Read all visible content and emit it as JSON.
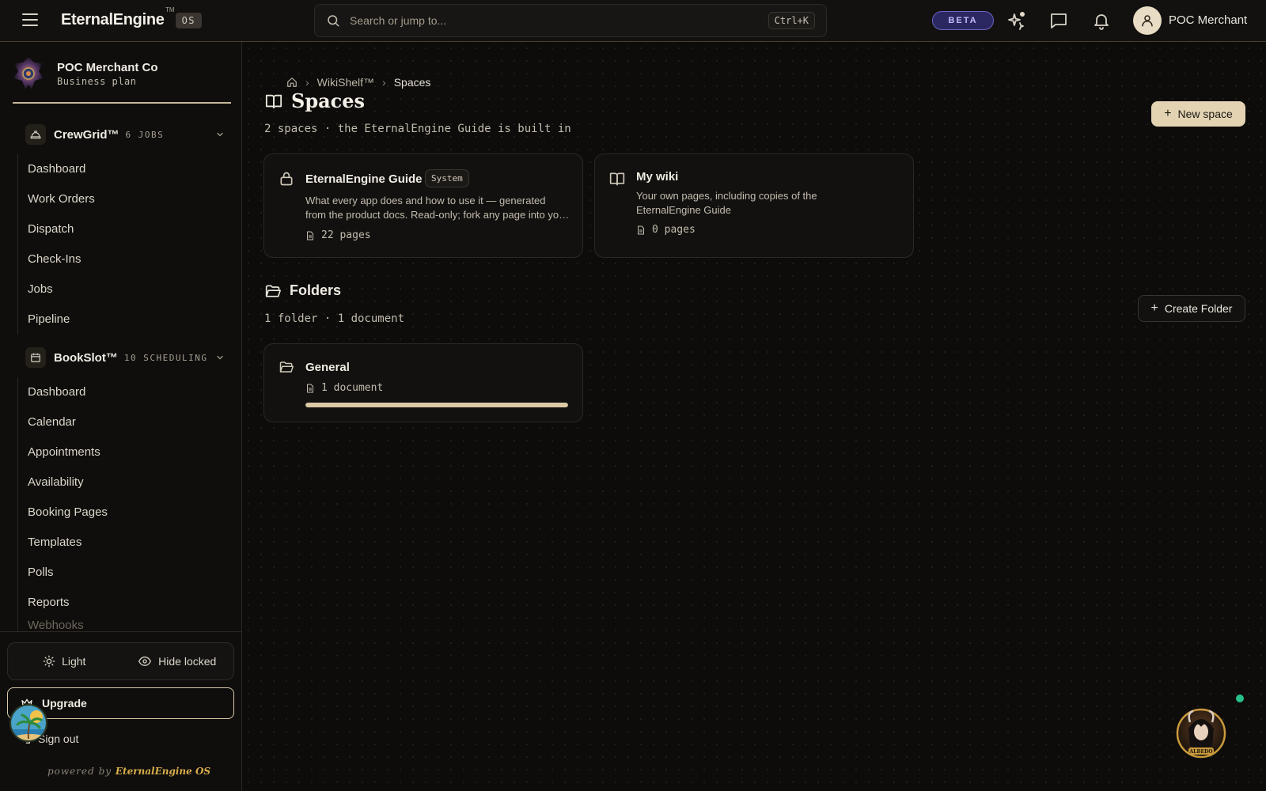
{
  "topbar": {
    "brand": "EternalEngine",
    "brand_tm": "TM",
    "brand_os": "OS",
    "search_placeholder": "Search or jump to...",
    "search_shortcut": "Ctrl+K",
    "beta_label": "BETA",
    "user_name": "POC Merchant"
  },
  "sidebar": {
    "org_name": "POC Merchant Co",
    "org_plan": "Business plan",
    "apps": [
      {
        "name": "CrewGrid™",
        "meta": "6 JOBS",
        "items": [
          "Dashboard",
          "Work Orders",
          "Dispatch",
          "Check-Ins",
          "Jobs",
          "Pipeline"
        ]
      },
      {
        "name": "BookSlot™",
        "meta": "10 SCHEDULING",
        "items": [
          "Dashboard",
          "Calendar",
          "Appointments",
          "Availability",
          "Booking Pages",
          "Templates",
          "Polls",
          "Reports",
          "Webhooks"
        ]
      }
    ],
    "light_label": "Light",
    "hide_locked_label": "Hide locked",
    "upgrade_label": "Upgrade",
    "signout_label": "Sign out",
    "powered_prefix": "powered by",
    "powered_brand": "EternalEngine OS"
  },
  "main": {
    "breadcrumb": [
      "WikiShelf™",
      "Spaces"
    ],
    "title": "Spaces",
    "subtitle": "2 spaces · the EternalEngine Guide is built in",
    "new_space_label": "New space",
    "spaces": [
      {
        "title": "EternalEngine Guide",
        "badge": "System",
        "desc_line1": "What every app does and how to use it — generated",
        "desc_line2": "from the product docs. Read-only; fork any page into your wiki to edit.",
        "pages": "22 pages"
      },
      {
        "title": "My wiki",
        "desc_line1": "Your own pages, including copies of the",
        "desc_line2": "EternalEngine Guide",
        "pages": "0 pages"
      }
    ],
    "folders_title": "Folders",
    "folders_subtitle": "1 folder · 1 document",
    "create_folder_label": "Create Folder",
    "folders": [
      {
        "title": "General",
        "docs": "1 document",
        "progress": 1.0
      }
    ],
    "assistant_label": "ALBEDO"
  },
  "colors": {
    "accent": "#e3d3b3",
    "beta": "#6c64c9",
    "status_online": "#27c08b",
    "powered_brand": "#d8ad4b"
  },
  "icons": {
    "menu": "hamburger-icon",
    "search": "search-icon",
    "sparkle": "sparkle-icon",
    "chat": "chat-icon",
    "bell": "bell-icon",
    "user": "user-icon",
    "home": "home-icon",
    "book": "book-open-icon",
    "lock": "lock-icon",
    "folder": "folder-open-icon",
    "doc": "document-icon"
  }
}
